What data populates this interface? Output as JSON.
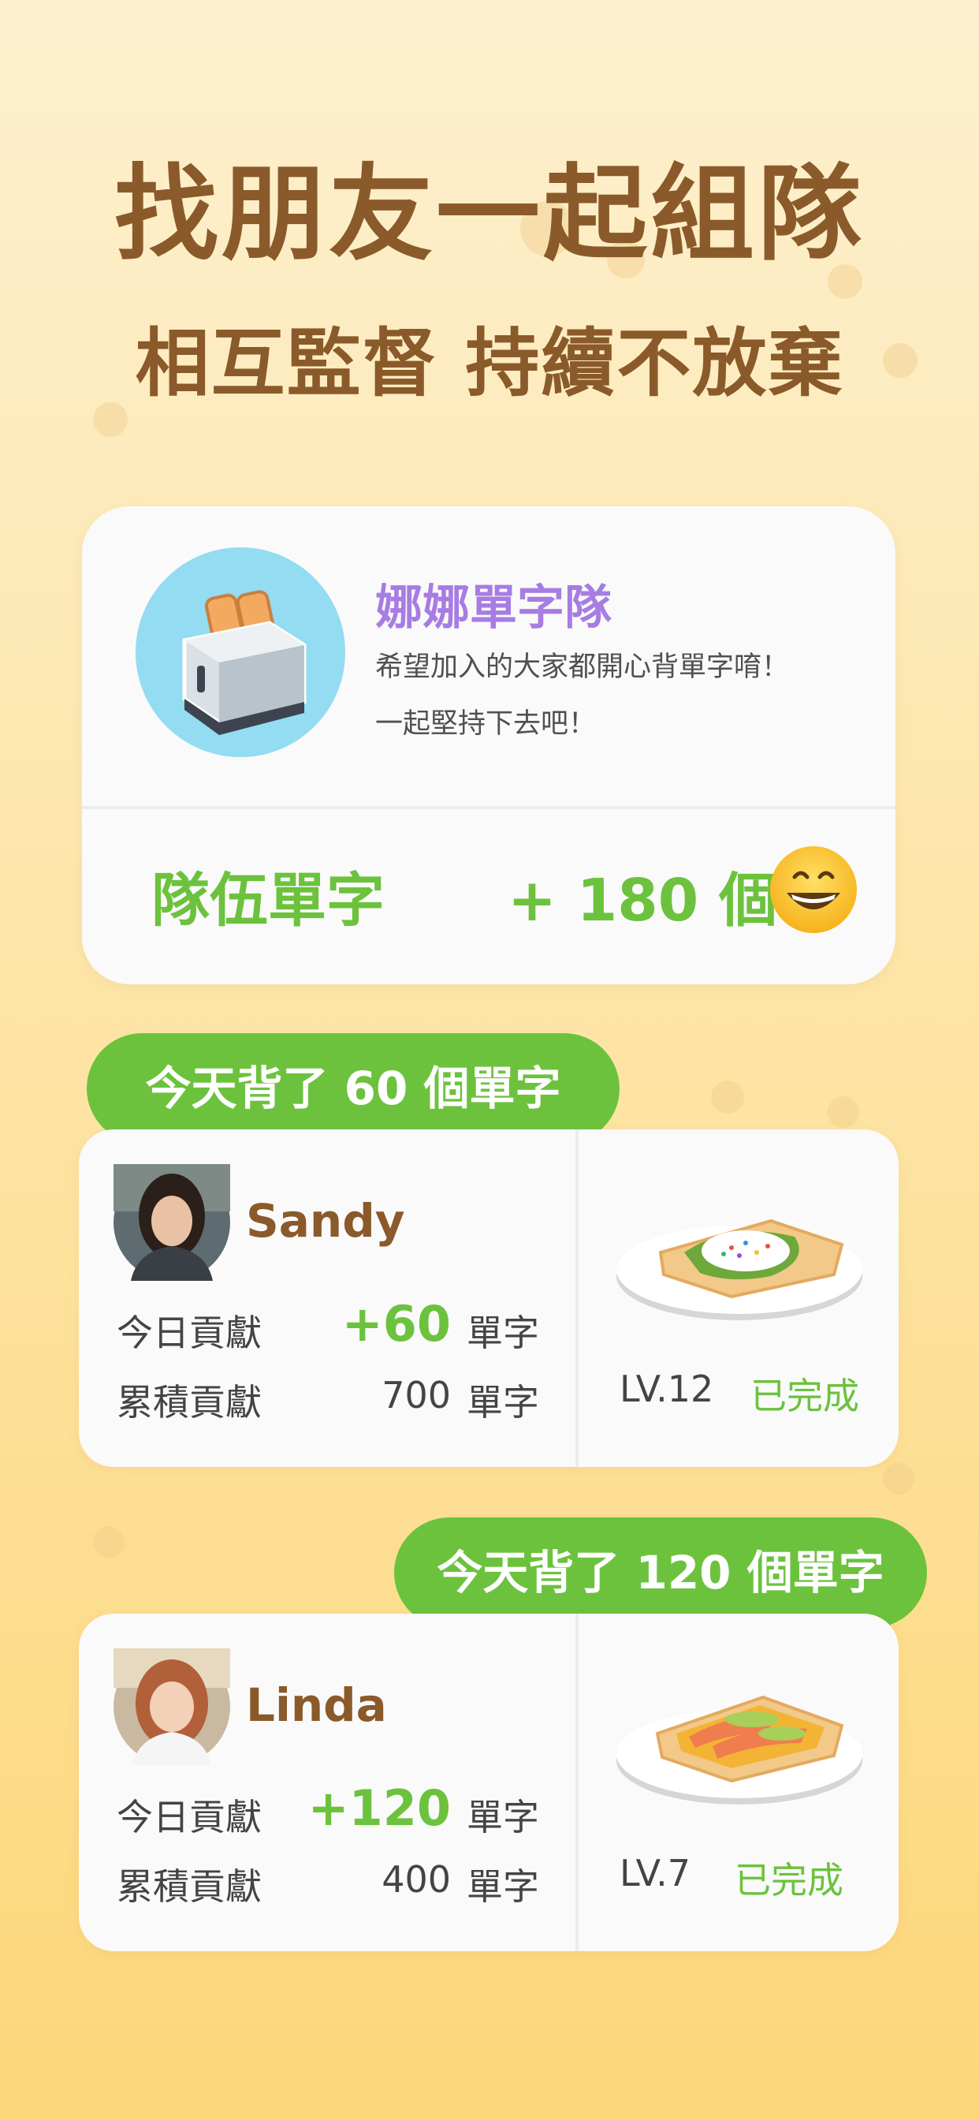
{
  "header": {
    "title": "找朋友一起組隊",
    "subtitle": "相互監督 持續不放棄"
  },
  "team": {
    "name": "娜娜單字隊",
    "description_line1": "希望加入的大家都開心背單字唷！",
    "description_line2": "一起堅持下去吧！",
    "words_label": "隊伍單字",
    "words_count": "+ 180 個",
    "icon": "toaster-icon",
    "emoji": "grinning-face-icon"
  },
  "members": [
    {
      "bubble": "今天背了 60 個單字",
      "name": "Sandy",
      "today_label": "今日貢獻",
      "today_value": "+60",
      "today_unit": "單字",
      "total_label": "累積貢獻",
      "total_value": "700",
      "total_unit": "單字",
      "level": "LV.12",
      "status": "已完成",
      "food_icon": "avocado-toast-icon"
    },
    {
      "bubble": "今天背了 120 個單字",
      "name": "Linda",
      "today_label": "今日貢獻",
      "today_value": "+120",
      "today_unit": "單字",
      "total_label": "累積貢獻",
      "total_value": "400",
      "total_unit": "單字",
      "level": "LV.7",
      "status": "已完成",
      "food_icon": "salmon-toast-icon"
    }
  ],
  "colors": {
    "accent_green": "#6cc23d",
    "title_brown": "#8a5a2b",
    "team_purple": "#a77ce3"
  }
}
